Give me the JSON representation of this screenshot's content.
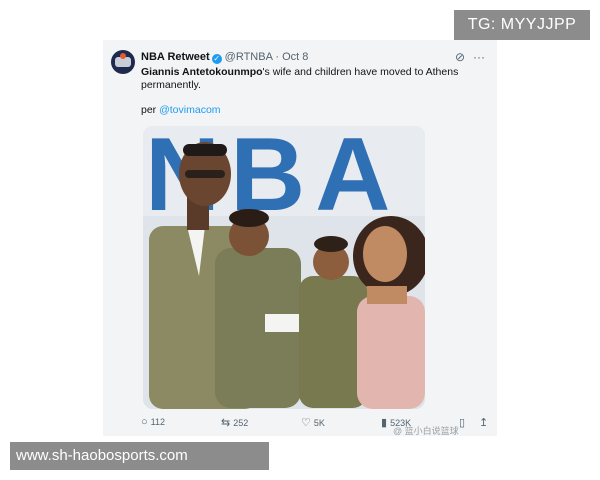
{
  "overlay": {
    "telegram_tag": "TG: MYYJJPP",
    "site_url": "www.sh-haobosports.com",
    "watermark": "@ 篮小白说篮球"
  },
  "tweet": {
    "account_name": "NBA Retweet",
    "handle": "@RTNBA",
    "date": "· Oct 8",
    "text_bold": "Giannis Antetokounmpo",
    "text_rest": "'s wife and children have moved to Athens permanently.",
    "per_label": "per",
    "per_link": "@tovimacom",
    "photo_backdrop_text": "NBA",
    "actions": {
      "replies": "112",
      "retweets": "252",
      "likes": "5K",
      "views": "523K"
    }
  },
  "colors": {
    "accent": "#1d9bf0",
    "card_bg": "#f3f4f5",
    "overlay_gray": "#8c8c8c"
  }
}
